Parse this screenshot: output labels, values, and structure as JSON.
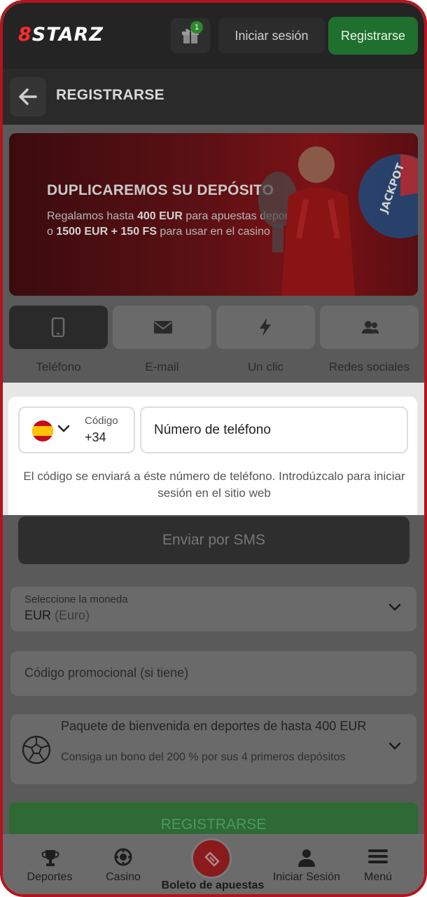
{
  "header": {
    "logo_prefix": "8",
    "logo_text": "STARZ",
    "gift_count": "1",
    "login_label": "Iniciar sesión",
    "register_label": "Registrarse"
  },
  "titlebar": {
    "title": "REGISTRARSE"
  },
  "banner": {
    "title": "DUPLICAREMOS SU DEPÓSITO",
    "line1_a": "Regalamos hasta ",
    "line1_b": "400 EUR",
    "line1_c": " para apuestas deportivas",
    "line2_a": "o ",
    "line2_b": "1500 EUR + 150 FS",
    "line2_c": " para usar en el casino",
    "wheel_text": "JACKPOT"
  },
  "tabs": [
    {
      "label": "Teléfono",
      "icon": "smartphone-icon",
      "active": true
    },
    {
      "label": "E-mail",
      "icon": "envelope-icon",
      "active": false
    },
    {
      "label": "Un clic",
      "icon": "lightning-icon",
      "active": false
    },
    {
      "label": "Redes sociales",
      "icon": "users-icon",
      "active": false
    }
  ],
  "phone": {
    "country_flag": "spain-flag",
    "code_label": "Código",
    "code_value": "+34",
    "placeholder": "Número de teléfono",
    "note": "El código se enviará a éste número de teléfono. Introdúzcalo para iniciar sesión en el sitio web"
  },
  "sms_button": "Enviar por SMS",
  "currency": {
    "label": "Seleccione la moneda",
    "code": "EUR",
    "name": "(Euro)"
  },
  "promo": {
    "placeholder": "Código promocional (si tiene)"
  },
  "bonus": {
    "title": "Paquete de bienvenida en deportes de hasta 400 EUR",
    "description": "Consiga un bono del 200 % por sus 4 primeros depósitos"
  },
  "register_button": "REGISTRARSE",
  "bottom_nav": {
    "sports": "Deportes",
    "casino": "Casino",
    "betslip": "Boleto de apuestas",
    "login": "Iniciar Sesión",
    "menu": "Menú"
  },
  "colors": {
    "frame": "#b3141d",
    "header_bg": "#242424",
    "register_green": "#1f6f2e",
    "overlay_dim": "#5a5a5a"
  }
}
